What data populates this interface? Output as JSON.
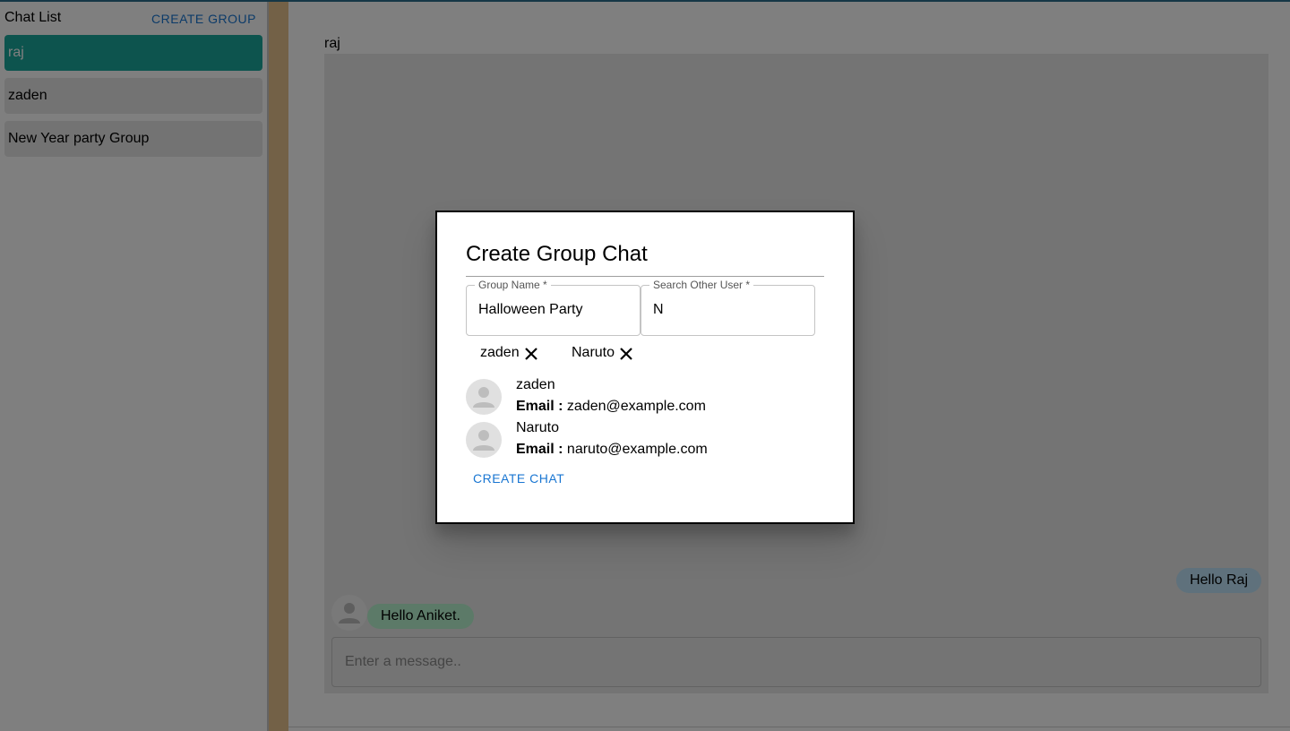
{
  "sidebar": {
    "title": "Chat List",
    "create_group_label": "CREATE GROUP",
    "chats": [
      {
        "label": "raj",
        "active": true
      },
      {
        "label": "zaden",
        "active": false
      },
      {
        "label": "New Year party Group",
        "active": false
      }
    ]
  },
  "main": {
    "chat_title": "raj",
    "messages": [
      {
        "text": "Hello Raj",
        "side": "right"
      },
      {
        "text": "Hello Aniket.",
        "side": "left"
      }
    ],
    "input_placeholder": "Enter a message.."
  },
  "modal": {
    "title": "Create Group Chat",
    "group_name_label": "Group Name *",
    "group_name_value": "Halloween Party",
    "search_label": "Search Other User *",
    "search_value": "N",
    "selected_chips": [
      "zaden",
      "Naruto"
    ],
    "users": [
      {
        "name": "zaden",
        "email_label": "Email :",
        "email": "zaden@example.com"
      },
      {
        "name": "Naruto",
        "email_label": "Email :",
        "email": "naruto@example.com"
      }
    ],
    "create_chat_label": "CREATE CHAT"
  },
  "colors": {
    "accent": "#1976d2",
    "active_chat": "#1aa99c",
    "sent_bubble": "#bee3f8",
    "received_bubble": "#b9f5d0",
    "divider_strip": "#e6c28f"
  }
}
